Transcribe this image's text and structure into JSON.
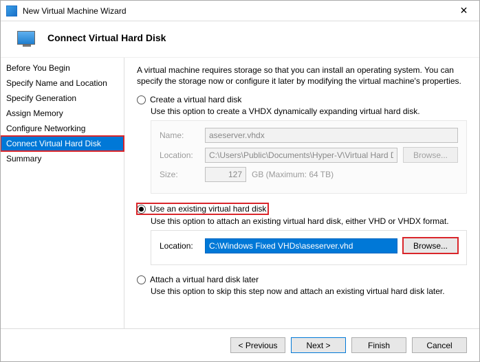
{
  "window": {
    "title": "New Virtual Machine Wizard"
  },
  "header": {
    "title": "Connect Virtual Hard Disk"
  },
  "sidebar": {
    "items": [
      {
        "label": "Before You Begin"
      },
      {
        "label": "Specify Name and Location"
      },
      {
        "label": "Specify Generation"
      },
      {
        "label": "Assign Memory"
      },
      {
        "label": "Configure Networking"
      },
      {
        "label": "Connect Virtual Hard Disk"
      },
      {
        "label": "Summary"
      }
    ]
  },
  "content": {
    "intro": "A virtual machine requires storage so that you can install an operating system. You can specify the storage now or configure it later by modifying the virtual machine's properties.",
    "opt_create": {
      "label": "Create a virtual hard disk",
      "desc": "Use this option to create a VHDX dynamically expanding virtual hard disk.",
      "name_label": "Name:",
      "name_value": "aseserver.vhdx",
      "loc_label": "Location:",
      "loc_value": "C:\\Users\\Public\\Documents\\Hyper-V\\Virtual Hard Disks\\",
      "browse_label": "Browse...",
      "size_label": "Size:",
      "size_value": "127",
      "size_suffix": "GB (Maximum: 64 TB)"
    },
    "opt_existing": {
      "label": "Use an existing virtual hard disk",
      "desc": "Use this option to attach an existing virtual hard disk, either VHD or VHDX format.",
      "loc_label": "Location:",
      "loc_value": "C:\\Windows Fixed VHDs\\aseserver.vhd",
      "browse_label": "Browse..."
    },
    "opt_later": {
      "label": "Attach a virtual hard disk later",
      "desc": "Use this option to skip this step now and attach an existing virtual hard disk later."
    }
  },
  "footer": {
    "previous": "< Previous",
    "next": "Next >",
    "finish": "Finish",
    "cancel": "Cancel"
  }
}
